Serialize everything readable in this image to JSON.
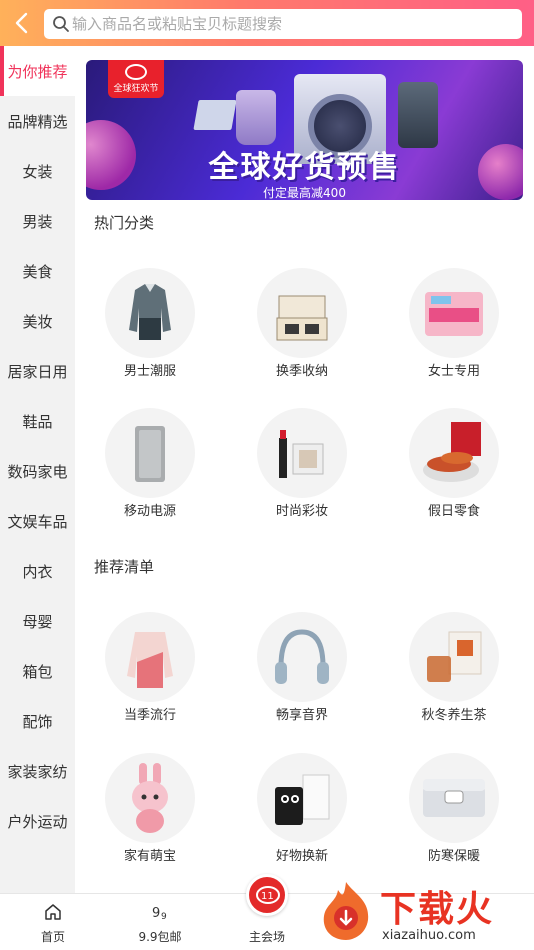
{
  "header": {
    "search_placeholder": "输入商品名或粘贴宝贝标题搜索"
  },
  "sidebar": {
    "items": [
      {
        "label": "为你推荐",
        "active": true
      },
      {
        "label": "品牌精选"
      },
      {
        "label": "女装"
      },
      {
        "label": "男装"
      },
      {
        "label": "美食"
      },
      {
        "label": "美妆"
      },
      {
        "label": "居家日用"
      },
      {
        "label": "鞋品"
      },
      {
        "label": "数码家电"
      },
      {
        "label": "文娱车品"
      },
      {
        "label": "内衣"
      },
      {
        "label": "母婴"
      },
      {
        "label": "箱包"
      },
      {
        "label": "配饰"
      },
      {
        "label": "家装家纺"
      },
      {
        "label": "户外运动"
      }
    ]
  },
  "banner": {
    "badge_text": "全球狂欢节",
    "title": "全球好货预售",
    "subtitle": "付定最高减400"
  },
  "hot_categories": {
    "title": "热门分类",
    "items": [
      {
        "label": "男士潮服",
        "icon": "jacket-icon"
      },
      {
        "label": "换季收纳",
        "icon": "storage-box-icon"
      },
      {
        "label": "女士专用",
        "icon": "sanitary-pad-icon"
      },
      {
        "label": "移动电源",
        "icon": "power-bank-icon"
      },
      {
        "label": "时尚彩妆",
        "icon": "lipstick-icon"
      },
      {
        "label": "假日零食",
        "icon": "snack-icon"
      }
    ]
  },
  "recommended": {
    "title": "推荐清单",
    "items": [
      {
        "label": "当季流行",
        "icon": "sweater-icon"
      },
      {
        "label": "畅享音界",
        "icon": "headphones-icon"
      },
      {
        "label": "秋冬养生茶",
        "icon": "tea-icon"
      },
      {
        "label": "家有萌宝",
        "icon": "toy-bunny-icon"
      },
      {
        "label": "好物换新",
        "icon": "candle-icon"
      },
      {
        "label": "防寒保暖",
        "icon": "electric-blanket-icon"
      }
    ]
  },
  "bottom_nav": {
    "items": [
      {
        "label": "首页",
        "icon": "home-icon"
      },
      {
        "label": "9.9包邮",
        "icon": "nine-nine-icon"
      },
      {
        "label": "主会场",
        "icon": "double-eleven-icon"
      }
    ]
  },
  "watermark": {
    "text": "下载火",
    "url": "xiazaihuo.com"
  },
  "colors": {
    "accent": "#f0335a",
    "header_start": "#ffb15a",
    "header_end": "#ff5f86"
  }
}
